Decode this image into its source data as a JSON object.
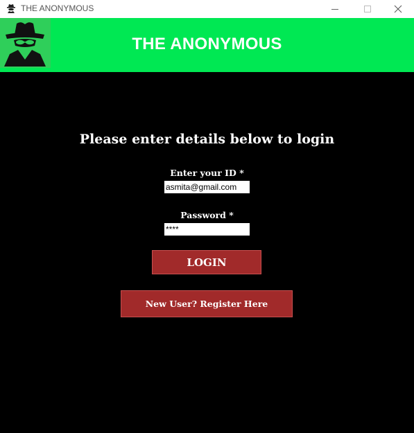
{
  "window": {
    "title": "THE ANONYMOUS",
    "app_icon": "spy-icon",
    "controls": [
      "minimize",
      "maximize",
      "close"
    ]
  },
  "header": {
    "title": "THE ANONYMOUS",
    "logo": "hacker-spy-icon",
    "bg_color": "#00e853"
  },
  "login": {
    "heading": "Please enter details below to login",
    "id_label": "Enter your ID *",
    "id_value": "asmita@gmail.com",
    "password_label": "Password *",
    "password_value": "****",
    "login_button": "LOGIN",
    "register_button": "New User? Register Here",
    "button_color": "#a12a2a"
  }
}
